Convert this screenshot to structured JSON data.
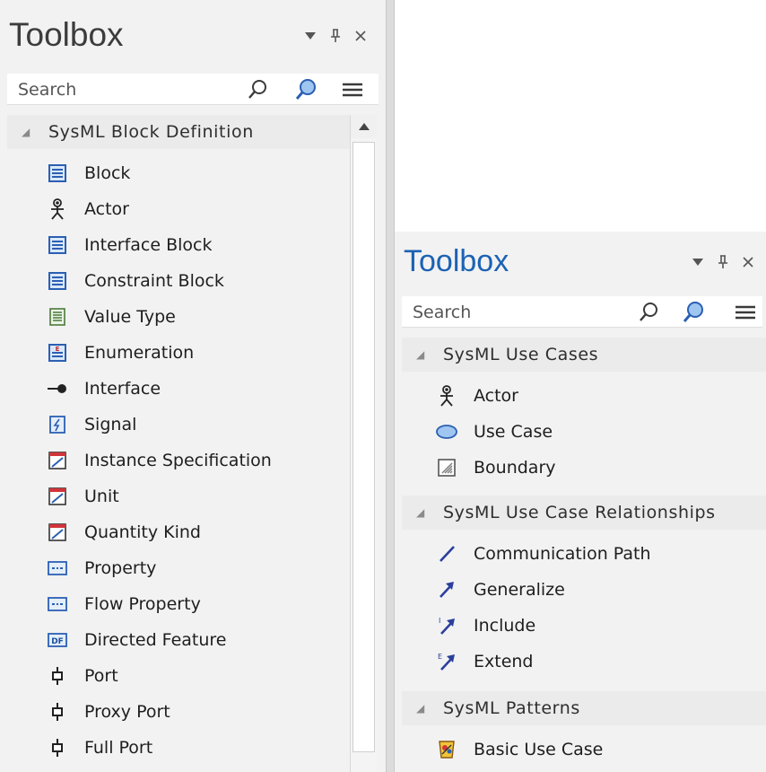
{
  "left": {
    "title": "Toolbox",
    "search_placeholder": "Search",
    "group": "SysML Block Definition",
    "items": [
      {
        "label": "Block",
        "icon": "block-icon"
      },
      {
        "label": "Actor",
        "icon": "actor-icon"
      },
      {
        "label": "Interface Block",
        "icon": "interface-block-icon"
      },
      {
        "label": "Constraint Block",
        "icon": "constraint-block-icon"
      },
      {
        "label": "Value Type",
        "icon": "value-type-icon"
      },
      {
        "label": "Enumeration",
        "icon": "enumeration-icon"
      },
      {
        "label": "Interface",
        "icon": "interface-icon"
      },
      {
        "label": "Signal",
        "icon": "signal-icon"
      },
      {
        "label": "Instance Specification",
        "icon": "instance-specification-icon"
      },
      {
        "label": "Unit",
        "icon": "unit-icon"
      },
      {
        "label": "Quantity Kind",
        "icon": "quantity-kind-icon"
      },
      {
        "label": "Property",
        "icon": "property-icon"
      },
      {
        "label": "Flow Property",
        "icon": "flow-property-icon"
      },
      {
        "label": "Directed Feature",
        "icon": "directed-feature-icon"
      },
      {
        "label": "Port",
        "icon": "port-icon"
      },
      {
        "label": "Proxy Port",
        "icon": "proxy-port-icon"
      },
      {
        "label": "Full Port",
        "icon": "full-port-icon"
      }
    ]
  },
  "right": {
    "title": "Toolbox",
    "search_placeholder": "Search",
    "groups": [
      {
        "label": "SysML Use Cases",
        "items": [
          {
            "label": "Actor",
            "icon": "actor-icon"
          },
          {
            "label": "Use Case",
            "icon": "use-case-icon"
          },
          {
            "label": "Boundary",
            "icon": "boundary-icon"
          }
        ]
      },
      {
        "label": "SysML Use Case Relationships",
        "items": [
          {
            "label": "Communication Path",
            "icon": "communication-path-icon"
          },
          {
            "label": "Generalize",
            "icon": "generalize-icon"
          },
          {
            "label": "Include",
            "icon": "include-icon"
          },
          {
            "label": "Extend",
            "icon": "extend-icon"
          }
        ]
      },
      {
        "label": "SysML Patterns",
        "items": [
          {
            "label": "Basic Use Case",
            "icon": "basic-use-case-icon"
          }
        ]
      }
    ]
  },
  "icon_glyph_DF": "DF",
  "icon_glyph_E": "E",
  "icon_glyph_I": "I",
  "colors": {
    "title_active": "#1b62b4",
    "title_inactive": "#3c3c3c",
    "icon_blue": "#2b5fb3"
  }
}
